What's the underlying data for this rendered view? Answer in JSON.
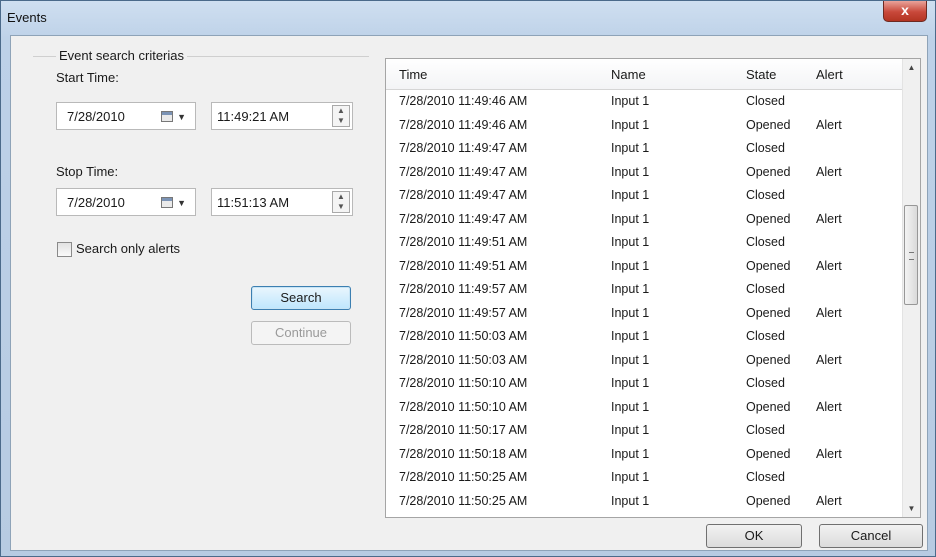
{
  "window": {
    "title": "Events",
    "close_glyph": "x"
  },
  "criteria": {
    "group_label": "Event search criterias",
    "start_label": "Start Time:",
    "start_date": "7/28/2010",
    "start_time": "11:49:21 AM",
    "stop_label": "Stop Time:",
    "stop_date": "7/28/2010",
    "stop_time": "11:51:13 AM",
    "alerts_only_label": "Search only alerts",
    "alerts_only_checked": false,
    "search_label": "Search",
    "continue_label": "Continue"
  },
  "events": {
    "columns": [
      "Time",
      "Name",
      "State",
      "Alert"
    ],
    "rows": [
      [
        "7/28/2010 11:49:46 AM",
        "Input 1",
        "Closed",
        ""
      ],
      [
        "7/28/2010 11:49:46 AM",
        "Input 1",
        "Opened",
        "Alert"
      ],
      [
        "7/28/2010 11:49:47 AM",
        "Input 1",
        "Closed",
        ""
      ],
      [
        "7/28/2010 11:49:47 AM",
        "Input 1",
        "Opened",
        "Alert"
      ],
      [
        "7/28/2010 11:49:47 AM",
        "Input 1",
        "Closed",
        ""
      ],
      [
        "7/28/2010 11:49:47 AM",
        "Input 1",
        "Opened",
        "Alert"
      ],
      [
        "7/28/2010 11:49:51 AM",
        "Input 1",
        "Closed",
        ""
      ],
      [
        "7/28/2010 11:49:51 AM",
        "Input 1",
        "Opened",
        "Alert"
      ],
      [
        "7/28/2010 11:49:57 AM",
        "Input 1",
        "Closed",
        ""
      ],
      [
        "7/28/2010 11:49:57 AM",
        "Input 1",
        "Opened",
        "Alert"
      ],
      [
        "7/28/2010 11:50:03 AM",
        "Input 1",
        "Closed",
        ""
      ],
      [
        "7/28/2010 11:50:03 AM",
        "Input 1",
        "Opened",
        "Alert"
      ],
      [
        "7/28/2010 11:50:10 AM",
        "Input 1",
        "Closed",
        ""
      ],
      [
        "7/28/2010 11:50:10 AM",
        "Input 1",
        "Opened",
        "Alert"
      ],
      [
        "7/28/2010 11:50:17 AM",
        "Input 1",
        "Closed",
        ""
      ],
      [
        "7/28/2010 11:50:18 AM",
        "Input 1",
        "Opened",
        "Alert"
      ],
      [
        "7/28/2010 11:50:25 AM",
        "Input 1",
        "Closed",
        ""
      ],
      [
        "7/28/2010 11:50:25 AM",
        "Input 1",
        "Opened",
        "Alert"
      ]
    ]
  },
  "footer": {
    "ok_label": "OK",
    "cancel_label": "Cancel"
  },
  "colors": {
    "close_button": "#c8483a",
    "default_button": "#bee6fd"
  }
}
